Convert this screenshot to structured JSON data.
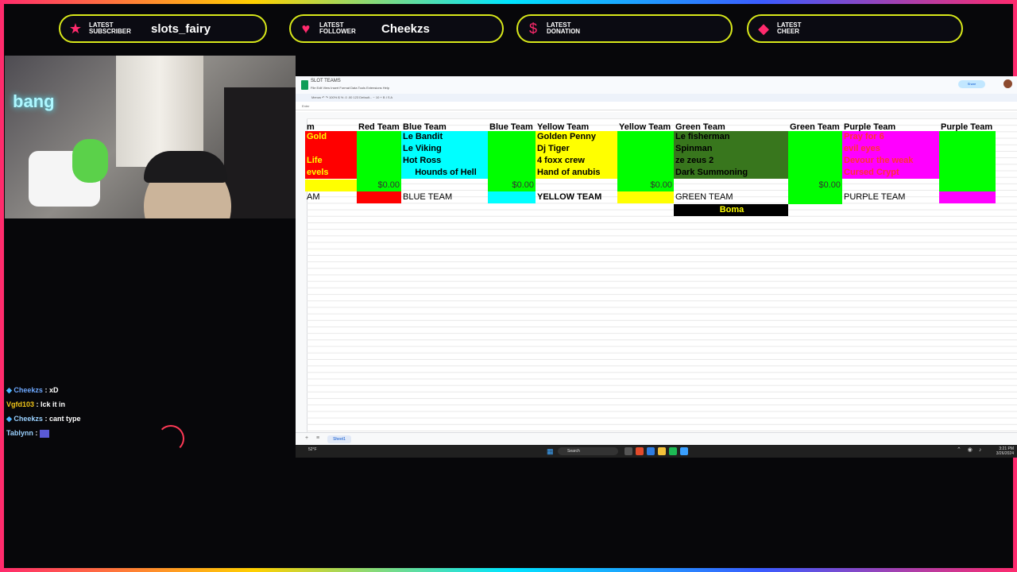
{
  "alerts": [
    {
      "label_line1": "LATEST",
      "label_line2": "SUBSCRIBER",
      "value": "slots_fairy",
      "icon": "star-icon"
    },
    {
      "label_line1": "LATEST",
      "label_line2": "FOLLOWER",
      "value": "Cheekzs",
      "icon": "heart-icon"
    },
    {
      "label_line1": "LATEST",
      "label_line2": "DONATION",
      "value": "",
      "icon": "dollar-icon"
    },
    {
      "label_line1": "LATEST",
      "label_line2": "CHEER",
      "value": "",
      "icon": "diamond-icon"
    }
  ],
  "webcam": {
    "neon_sign": "bang"
  },
  "chat": [
    {
      "user": "Cheekzs",
      "text": ": xD",
      "badge": "diamond-badge-icon"
    },
    {
      "user": "Vgfd103",
      "text": ": lck it in",
      "badge": ""
    },
    {
      "user": "Cheekzs",
      "text": ": cant type",
      "badge": "diamond-badge-icon"
    },
    {
      "user": "Tablynn",
      "text": ":",
      "badge": "",
      "emote": "emote-icon"
    }
  ],
  "sheet": {
    "doc_title": "SLOT TEAMS",
    "menus": "File  Edit  View  Insert  Format  Data  Tools  Extensions  Help",
    "tools": "Menus   ↶ ↷  100%  $  %  .0  .00  123  Default...  −  10  +  B  I  S  A",
    "formula": "Enter",
    "share_label": "Share",
    "sheet_tab": "Sheet1",
    "header_row": [
      "m",
      "Red Team",
      "Blue Team",
      "Blue Team",
      "Yellow Team",
      "Yellow Team",
      "Green Team",
      "Green Team",
      "Purple Team",
      "Purple Team"
    ],
    "red_items": [
      "Gold",
      "",
      "Life",
      "evels"
    ],
    "blue_items": [
      "Le Bandit",
      "Le Viking",
      "Hot Ross",
      "Hounds of Hell"
    ],
    "yellow_items": [
      "Golden Penny",
      "Dj Tiger",
      "4 foxx crew",
      "Hand of anubis"
    ],
    "green_items": [
      "Le fisherman",
      "Spinman",
      "ze zeus 2",
      "Dark Summoning"
    ],
    "purple_items": [
      "Pray for 6",
      "evil eyes",
      "Devour the weak",
      "Cursed Crypt"
    ],
    "amounts": [
      "$0.00",
      "$0.00",
      "$0.00",
      "$0.00"
    ],
    "team_labels": [
      "AM",
      "BLUE TEAM",
      "YELLOW TEAM",
      "GREEN TEAM",
      "PURPLE TEAM"
    ],
    "highlight_cell": "Boma",
    "colors": {
      "red": "#ff0000",
      "green": "#00ff00",
      "cyan": "#00ffff",
      "yellow": "#ffff00",
      "dark_green": "#38761d",
      "magenta": "#ff00ff",
      "black": "#000000"
    }
  },
  "taskbar": {
    "weather": "52°F",
    "search": "Search",
    "time": "3:21 PM",
    "date": "3/26/2024"
  }
}
